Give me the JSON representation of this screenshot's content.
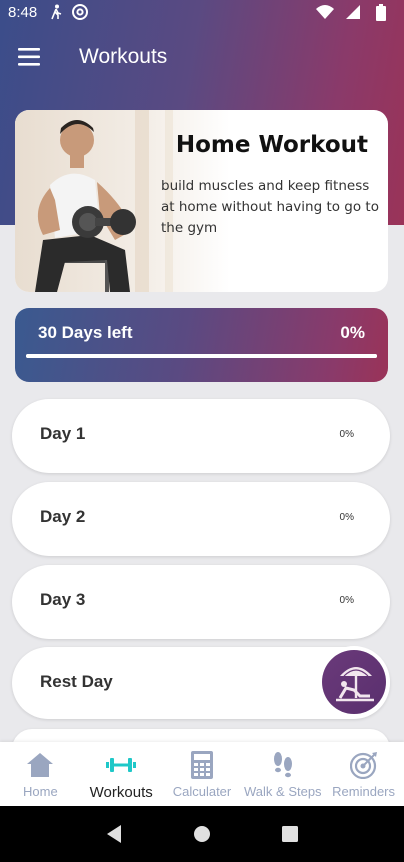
{
  "status_bar": {
    "time": "8:48",
    "left_icons": [
      "walk-icon",
      "at-sign-icon"
    ],
    "right_icons": [
      "wifi-icon",
      "signal-icon",
      "battery-icon"
    ]
  },
  "toolbar": {
    "title": "Workouts",
    "menu_icon": "hamburger-menu-icon"
  },
  "hero": {
    "title": "Home Workout",
    "description": "build muscles and keep fitness at home without having to go to the gym"
  },
  "progress": {
    "days_left": "30 Days left",
    "percent_label": "0%",
    "percent_value": 0
  },
  "days": [
    {
      "label": "Day 1",
      "percent": "0%"
    },
    {
      "label": "Day 2",
      "percent": "0%"
    },
    {
      "label": "Day 3",
      "percent": "0%"
    },
    {
      "label": "Rest Day",
      "percent": ""
    }
  ],
  "bottom_nav": {
    "items": [
      {
        "label": "Home",
        "icon": "home-icon",
        "active": false
      },
      {
        "label": "Workouts",
        "icon": "dumbbell-icon",
        "active": true
      },
      {
        "label": "Calculater",
        "icon": "calculator-icon",
        "active": false
      },
      {
        "label": "Walk & Steps",
        "icon": "footsteps-icon",
        "active": false
      },
      {
        "label": "Reminders",
        "icon": "target-icon",
        "active": false
      }
    ]
  },
  "colors": {
    "accent": "#1fc8c8",
    "gradient_start": "#3b4d8a",
    "gradient_end": "#9a3358",
    "nav_inactive": "#9aa6c0"
  }
}
